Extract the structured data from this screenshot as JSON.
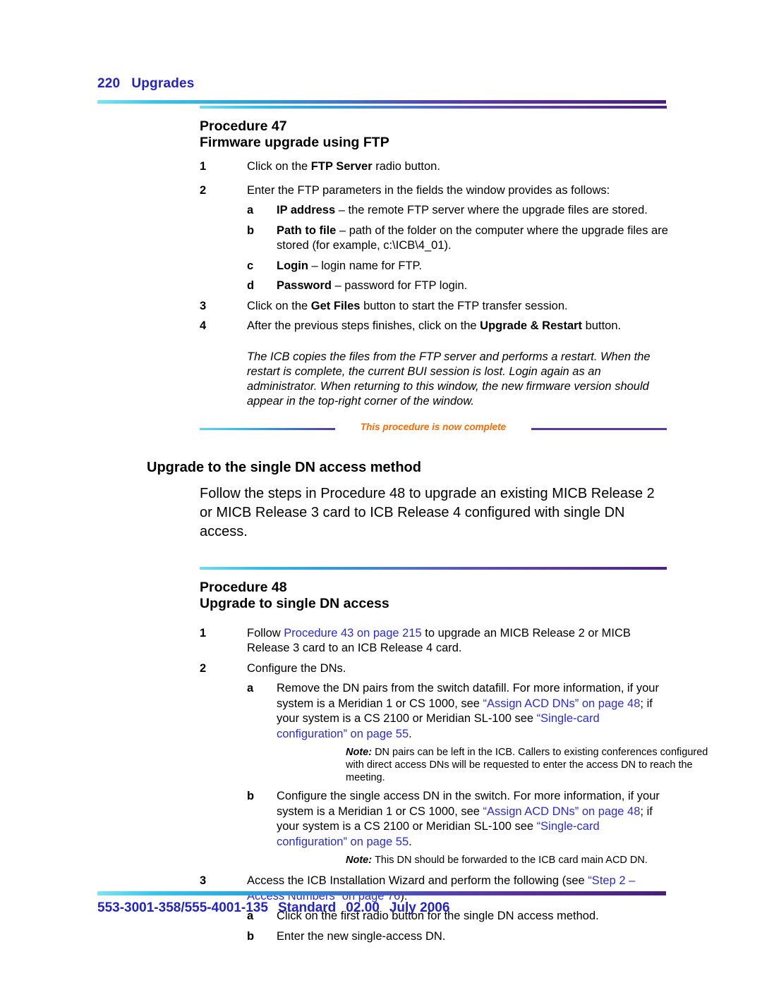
{
  "header": {
    "page_number": "220",
    "section_title": "Upgrades"
  },
  "footer": {
    "doc_number": "553-3001-358/555-4001-135",
    "status": "Standard",
    "issue": "02.00",
    "date": "July 2006"
  },
  "procedure47": {
    "label": "Procedure 47",
    "title": "Firmware upgrade using FTP",
    "steps": [
      {
        "marker": "1",
        "text_html": "Click on the <b>FTP Server</b> radio button."
      },
      {
        "marker": "2",
        "text_html": "Enter the FTP parameters in the fields the window provides as follows:"
      }
    ],
    "substeps": [
      {
        "marker": "a",
        "text_html": "<b>IP address</b> &ndash; the remote FTP server where the upgrade files are stored."
      },
      {
        "marker": "b",
        "text_html": "<b>Path to file</b> &ndash; path of the folder on the computer where the upgrade files are stored (for example, c:\\ICB\\4_01)."
      },
      {
        "marker": "c",
        "text_html": "<b>Login</b> &ndash; login name for FTP."
      },
      {
        "marker": "d",
        "text_html": "<b>Password</b> &ndash; password for FTP login."
      }
    ],
    "steps_after": [
      {
        "marker": "3",
        "text_html": "Click on the <b>Get Files</b> button to start the FTP transfer session."
      },
      {
        "marker": "4",
        "text_html": "After the previous steps finishes, click on the <b>Upgrade &amp; Restart</b> button."
      }
    ],
    "result": "The ICB copies the files from the FTP server and performs a restart. When the restart is complete, the current BUI session is lost. Login again as an administrator. When returning to this window, the new firmware version should appear in the top-right corner of the window.",
    "complete_label": "This procedure is now complete"
  },
  "section": {
    "heading": "Upgrade to the single DN access method",
    "body": "Follow the steps in Procedure 48 to upgrade an existing MICB Release 2 or MICB Release 3 card to ICB Release 4 configured with single DN access."
  },
  "procedure48": {
    "label": "Procedure 48",
    "title": "Upgrade to single DN access",
    "step1": {
      "marker": "1",
      "text_html": "Follow <span class=\"lnk\">Procedure 43 on page 215</span> to upgrade an MICB Release 2 or MICB Release 3 card to an ICB Release 4 card."
    },
    "step2": {
      "marker": "2",
      "text_html": "Configure the DNs."
    },
    "step2a": {
      "marker": "a",
      "text_html": "Remove the DN pairs from the switch datafill. For more information, if your system is a Meridian 1 or CS 1000, see <span class=\"lnk\">&ldquo;Assign ACD DNs&rdquo; on page 48</span>; if your system is a CS 2100 or Meridian SL-100 see <span class=\"lnk\">&ldquo;Single-card configuration&rdquo; on page 55</span>."
    },
    "step2a_note": {
      "label": "Note:",
      "text": "DN pairs can be left in the ICB. Callers to existing conferences configured with direct access DNs will be requested to enter the access DN to reach the meeting."
    },
    "step2b": {
      "marker": "b",
      "text_html": "Configure the single access DN in the switch. For more information, if your system is a Meridian 1 or CS 1000, see <span class=\"lnk\">&ldquo;Assign ACD DNs&rdquo; on page 48</span>; if your system is a CS 2100 or Meridian SL-100 see <span class=\"lnk\">&ldquo;Single-card configuration&rdquo; on page 55</span>."
    },
    "step2b_note": {
      "label": "Note:",
      "text": "This DN should be forwarded to the ICB card main ACD DN."
    },
    "step3": {
      "marker": "3",
      "text_html": "Access the ICB Installation Wizard and perform the following (see <span class=\"lnk\">&ldquo;Step 2 &ndash; Access Numbers&rdquo; on page 76</span>):"
    },
    "step3a": {
      "marker": "a",
      "text_html": "Click on the first radio button for the single DN access method."
    },
    "step3b": {
      "marker": "b",
      "text_html": "Enter the new single-access DN."
    }
  },
  "colors": {
    "header_blue": "#2222cc",
    "link_blue": "#2b2bdd",
    "complete_orange": "#ff6a00",
    "rule_cyan": "#39c6ea",
    "rule_purple": "#4a1f7a"
  }
}
